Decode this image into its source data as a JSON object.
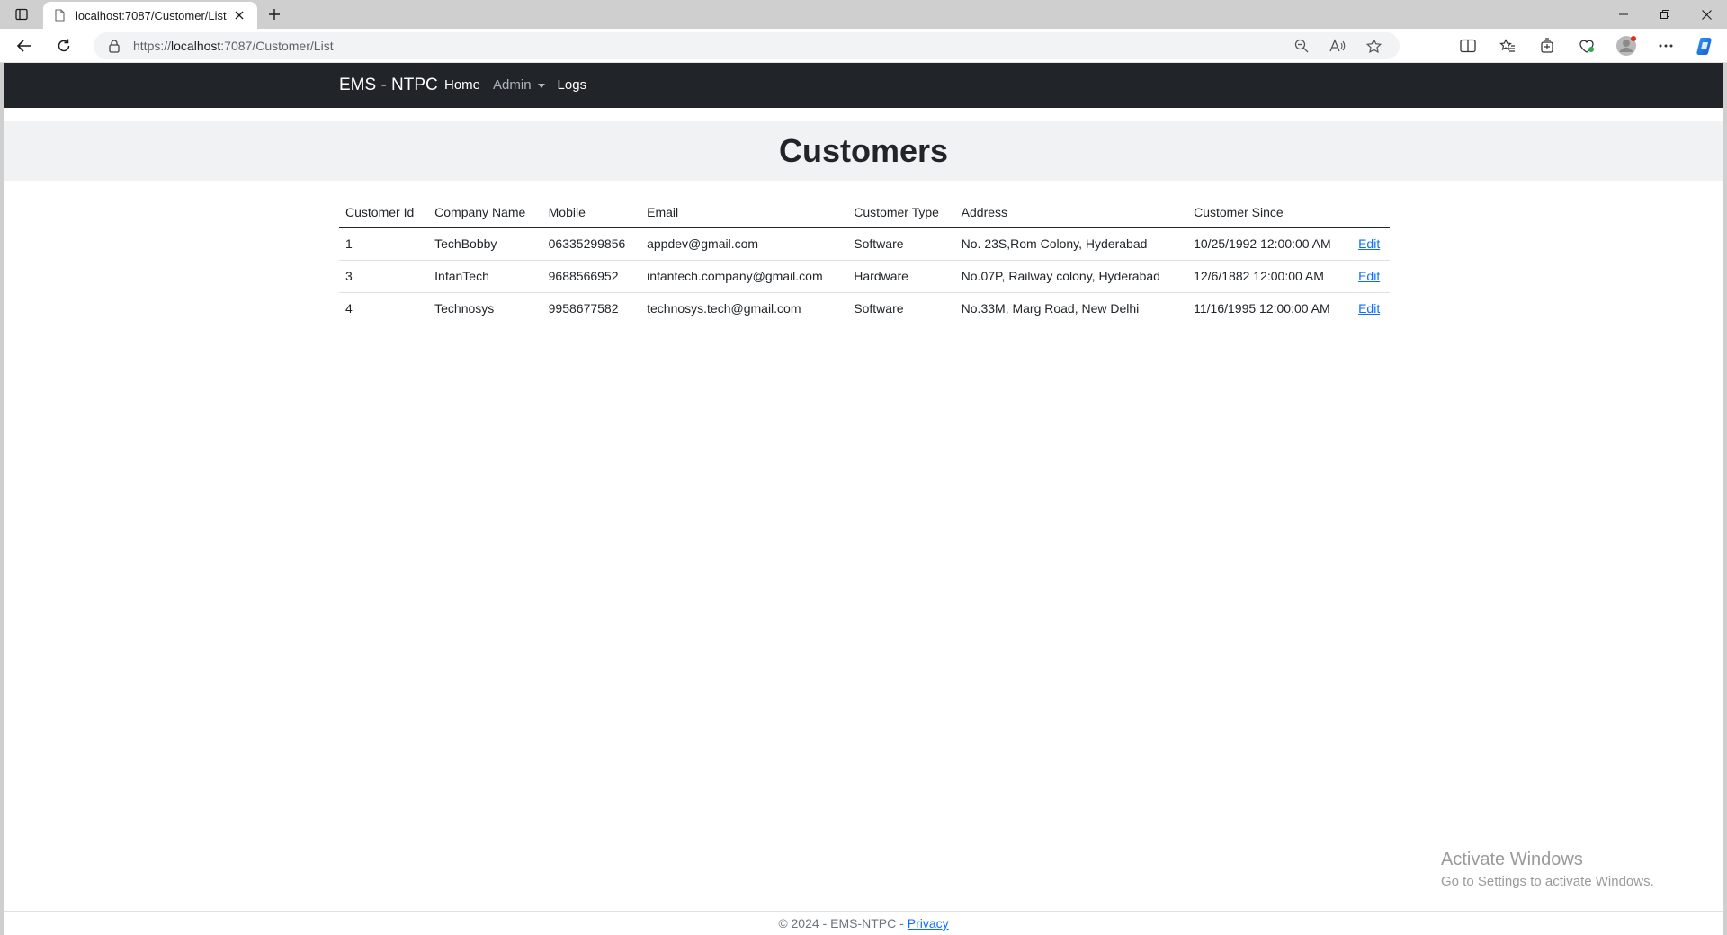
{
  "browser": {
    "tab_title": "localhost:7087/Customer/List",
    "url_prefix": "https://",
    "url_host": "localhost",
    "url_rest": ":7087/Customer/List"
  },
  "navbar": {
    "brand": "EMS - NTPC",
    "links": {
      "home": "Home",
      "admin": "Admin",
      "logs": "Logs"
    }
  },
  "page": {
    "title": "Customers"
  },
  "table": {
    "headers": [
      "Customer Id",
      "Company Name",
      "Mobile",
      "Email",
      "Customer Type",
      "Address",
      "Customer Since",
      ""
    ],
    "rows": [
      {
        "id": "1",
        "company": "TechBobby",
        "mobile": "06335299856",
        "email": "appdev@gmail.com",
        "type": "Software",
        "address": "No. 23S,Rom Colony, Hyderabad",
        "since": "10/25/1992 12:00:00 AM",
        "action": "Edit"
      },
      {
        "id": "3",
        "company": "InfanTech",
        "mobile": "9688566952",
        "email": "infantech.company@gmail.com",
        "type": "Hardware",
        "address": "No.07P, Railway colony, Hyderabad",
        "since": "12/6/1882 12:00:00 AM",
        "action": "Edit"
      },
      {
        "id": "4",
        "company": "Technosys",
        "mobile": "9958677582",
        "email": "technosys.tech@gmail.com",
        "type": "Software",
        "address": "No.33M, Marg Road, New Delhi",
        "since": "11/16/1995 12:00:00 AM",
        "action": "Edit"
      }
    ]
  },
  "watermark": {
    "line1": "Activate Windows",
    "line2": "Go to Settings to activate Windows."
  },
  "footer": {
    "text": "© 2024 - EMS-NTPC -",
    "privacy": "Privacy"
  },
  "colors": {
    "navbar_bg": "#212529",
    "hero_bg": "#f1f2f4",
    "link": "#0d6efd"
  }
}
